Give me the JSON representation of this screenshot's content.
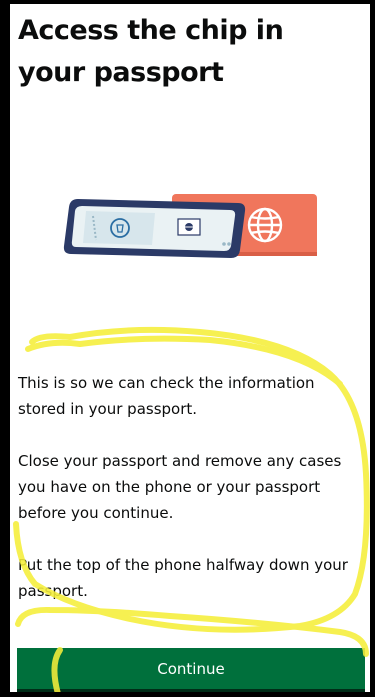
{
  "page": {
    "title": "Access the chip in your passport"
  },
  "illustration": {
    "icon": "phone-on-passport-icon",
    "phone_color": "#2b3a67",
    "passport_color": "#f0765c"
  },
  "body": {
    "paragraphs": [
      "This is so we can check the information stored in your passport.",
      "Close your passport and remove any cases you have on the phone or your passport before you continue.",
      "Put the top of the phone halfway down your passport."
    ]
  },
  "actions": {
    "continue_label": "Continue",
    "button_color": "#00703c"
  },
  "annotation": {
    "highlighter_color": "#f5ee3a"
  }
}
